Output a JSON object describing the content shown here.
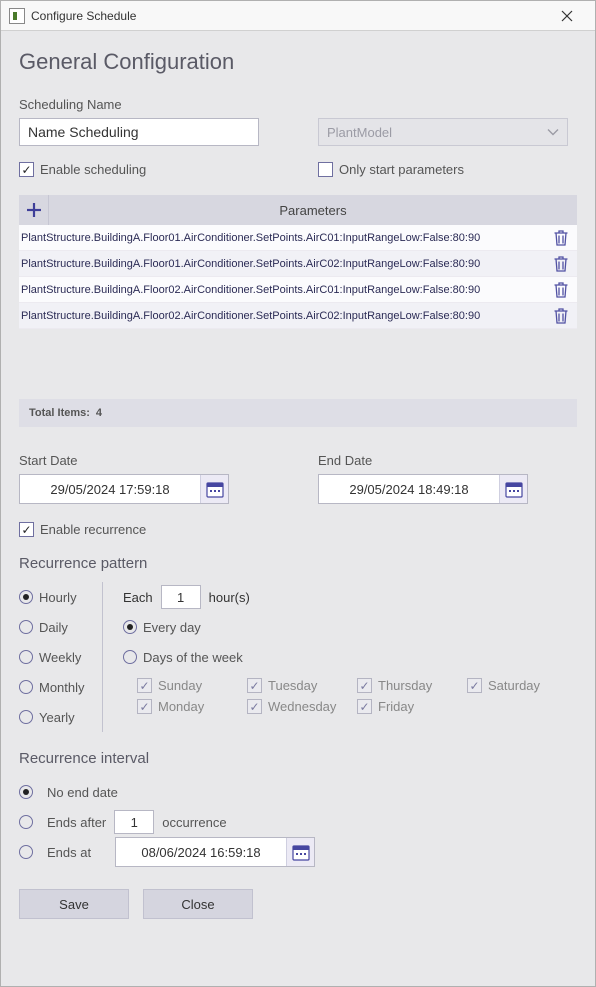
{
  "window": {
    "title": "Configure Schedule"
  },
  "page": {
    "heading": "General Configuration"
  },
  "scheduling_name": {
    "label": "Scheduling Name",
    "value": "Name Scheduling"
  },
  "model_select": {
    "value": "PlantModel"
  },
  "enable_scheduling": {
    "label": "Enable scheduling",
    "checked": true
  },
  "only_start_parameters": {
    "label": "Only start parameters",
    "checked": false
  },
  "parameters": {
    "header": "Parameters",
    "items": [
      "PlantStructure.BuildingA.Floor01.AirConditioner.SetPoints.AirC01:InputRangeLow:False:80:90",
      "PlantStructure.BuildingA.Floor01.AirConditioner.SetPoints.AirC02:InputRangeLow:False:80:90",
      "PlantStructure.BuildingA.Floor02.AirConditioner.SetPoints.AirC01:InputRangeLow:False:80:90",
      "PlantStructure.BuildingA.Floor02.AirConditioner.SetPoints.AirC02:InputRangeLow:False:80:90"
    ],
    "total_label": "Total Items:",
    "total_value": "4"
  },
  "start_date": {
    "label": "Start Date",
    "value": "29/05/2024 17:59:18"
  },
  "end_date": {
    "label": "End Date",
    "value": "29/05/2024 18:49:18"
  },
  "enable_recurrence": {
    "label": "Enable recurrence",
    "checked": true
  },
  "recurrence_pattern": {
    "title": "Recurrence pattern",
    "options": {
      "hourly": "Hourly",
      "daily": "Daily",
      "weekly": "Weekly",
      "monthly": "Monthly",
      "yearly": "Yearly"
    },
    "selected": "hourly",
    "each_label_pre": "Each",
    "each_value": "1",
    "each_label_post": "hour(s)",
    "every_day": {
      "label": "Every day",
      "checked": true
    },
    "days_of_week_label": "Days of the week",
    "days": {
      "sunday": {
        "label": "Sunday",
        "checked": true
      },
      "monday": {
        "label": "Monday",
        "checked": true
      },
      "tuesday": {
        "label": "Tuesday",
        "checked": true
      },
      "wednesday": {
        "label": "Wednesday",
        "checked": true
      },
      "thursday": {
        "label": "Thursday",
        "checked": true
      },
      "friday": {
        "label": "Friday",
        "checked": true
      },
      "saturday": {
        "label": "Saturday",
        "checked": true
      }
    }
  },
  "recurrence_interval": {
    "title": "Recurrence interval",
    "no_end_date": {
      "label": "No end date",
      "checked": true
    },
    "ends_after": {
      "label": "Ends after",
      "value": "1",
      "suffix": "occurrence",
      "checked": false
    },
    "ends_at": {
      "label": "Ends at",
      "value": "08/06/2024 16:59:18",
      "checked": false
    }
  },
  "buttons": {
    "save": "Save",
    "close": "Close"
  }
}
